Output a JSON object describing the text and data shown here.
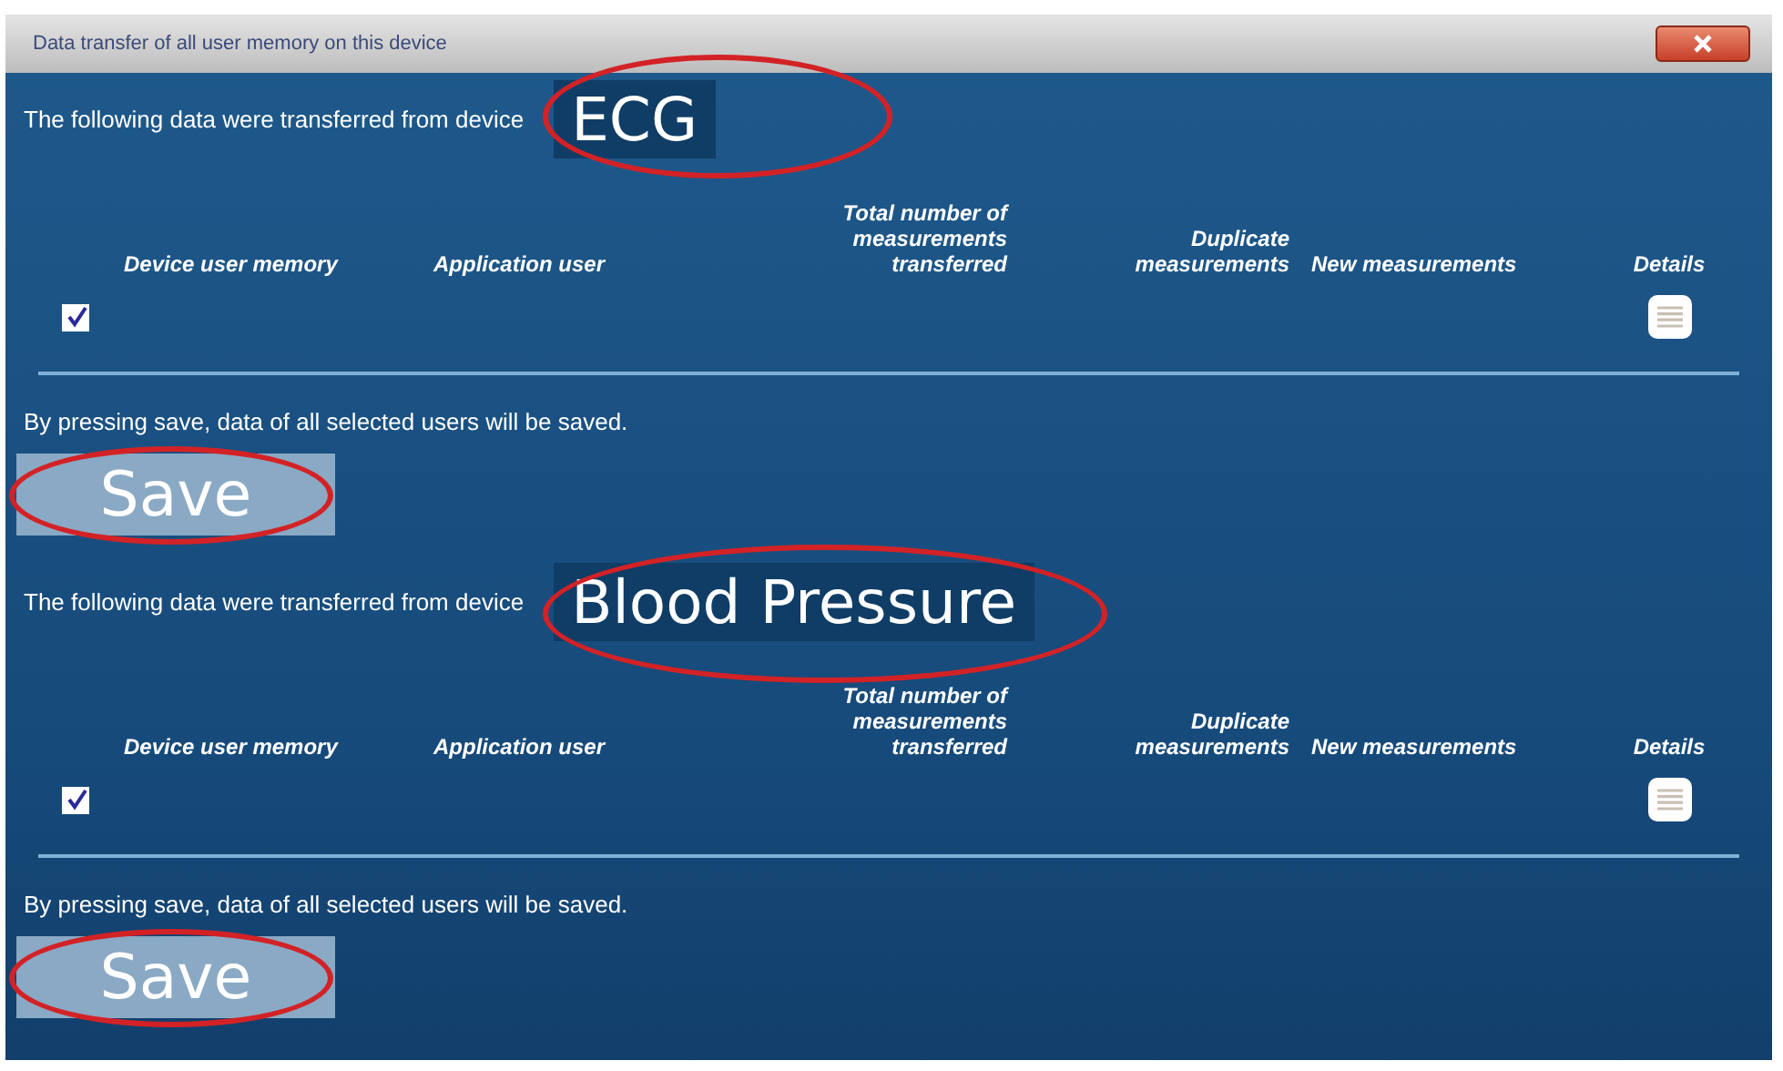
{
  "window": {
    "title": "Data transfer of all user memory on this device"
  },
  "sections": [
    {
      "intro": "The following data were transferred from device",
      "annotation": "ECG",
      "columns": [
        "Device user memory",
        "Application user",
        "Total number of measurements transferred",
        "Duplicate measurements",
        "New measurements",
        "Details"
      ],
      "rows": [
        {
          "checked": true
        }
      ],
      "note": "By pressing save, data of all selected users will be saved.",
      "save_button": "Save"
    },
    {
      "intro": "The following data were transferred from device",
      "annotation": "Blood Pressure",
      "columns": [
        "Device user memory",
        "Application user",
        "Total number of measurements transferred",
        "Duplicate measurements",
        "New measurements",
        "Details"
      ],
      "rows": [
        {
          "checked": true
        }
      ],
      "note": "By pressing save, data of all selected users will be saved.",
      "save_button": "Save"
    }
  ]
}
